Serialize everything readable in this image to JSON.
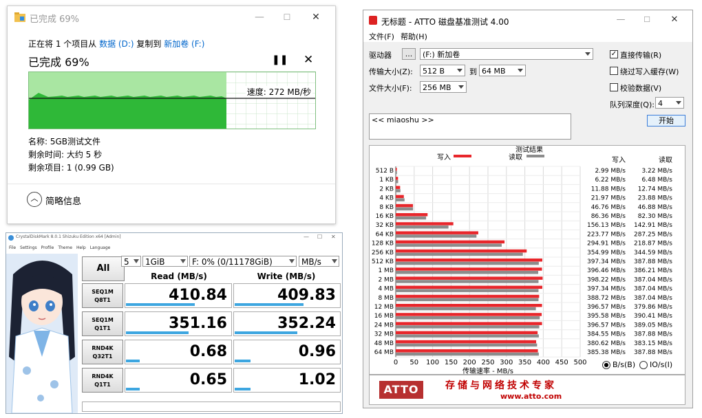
{
  "copy_dialog": {
    "title": "已完成 69%",
    "from_prefix": "正在将 1 个项目从 ",
    "source": "数据 (D:)",
    "mid": " 复制到 ",
    "dest": "新加卷 (F:)",
    "heading": "已完成 69%",
    "progress": 0.69,
    "speed_label": "速度: 272 MB/秒",
    "pause_glyph": "❚❚",
    "cancel_glyph": "✕",
    "name_line": "名称: 5GB测试文件",
    "time_line": "剩余时间: 大约 5 秒",
    "items_line": "剩余项目: 1 (0.99 GB)",
    "more_label": "简略信息",
    "minimize": "—",
    "maximize": "☐",
    "close": "✕"
  },
  "cdm": {
    "title": "CrystalDiskMark 8.0.1 Shizuku Edition x64 [Admin]",
    "menu": [
      "File",
      "Settings",
      "Profile",
      "Theme",
      "Help",
      "Language"
    ],
    "all_label": "All",
    "count": "5",
    "size": "1GiB",
    "drive": "F: 0% (0/11178GiB)",
    "unit": "MB/s",
    "read_header": "Read (MB/s)",
    "write_header": "Write (MB/s)",
    "rows": [
      {
        "l1": "SEQ1M",
        "l2": "Q8T1",
        "read": "410.84",
        "write": "409.83",
        "rfrac": 0.66,
        "wfrac": 0.66
      },
      {
        "l1": "SEQ1M",
        "l2": "Q1T1",
        "read": "351.16",
        "write": "352.24",
        "rfrac": 0.6,
        "wfrac": 0.6
      },
      {
        "l1": "RND4K",
        "l2": "Q32T1",
        "read": "0.68",
        "write": "0.96",
        "rfrac": 0.13,
        "wfrac": 0.15
      },
      {
        "l1": "RND4K",
        "l2": "Q1T1",
        "read": "0.65",
        "write": "1.02",
        "rfrac": 0.13,
        "wfrac": 0.15
      }
    ]
  },
  "atto": {
    "title": "无标题 - ATTO 磁盘基准测试 4.00",
    "menu_file": "文件(F)",
    "menu_help": "帮助(H)",
    "drive_label": "驱动器",
    "browse": "...",
    "drive_value": "(F:) 新加卷",
    "xfer_label": "传输大小(Z):",
    "xfer_from": "512 B",
    "to_label": "到",
    "xfer_to": "64 MB",
    "file_label": "文件大小(F):",
    "file_value": "256 MB",
    "direct": "直接传输(R)",
    "bypass": "绕过写入缓存(W)",
    "verify": "校验数据(V)",
    "queue_label": "队列深度(Q):",
    "queue_value": "4",
    "start": "开始",
    "description": "<< miaoshu >>",
    "results_title": "测试结果",
    "legend_write": "写入",
    "legend_read": "读取",
    "col_write": "写入",
    "col_read": "读取",
    "radio_bs": "B/s(B)",
    "radio_io": "IO/s(I)",
    "logo": "ATTO",
    "slogan": "存储与网络技术专家",
    "url": "www.atto.com",
    "colors": {
      "write": "#e8262b",
      "read": "#8c8c8c"
    },
    "chart_data": {
      "type": "bar",
      "orientation": "horizontal",
      "categories": [
        "512 B",
        "1 KB",
        "2 KB",
        "4 KB",
        "8 KB",
        "16 KB",
        "32 KB",
        "64 KB",
        "128 KB",
        "256 KB",
        "512 KB",
        "1 MB",
        "2 MB",
        "4 MB",
        "8 MB",
        "12 MB",
        "16 MB",
        "24 MB",
        "32 MB",
        "48 MB",
        "64 MB"
      ],
      "series": [
        {
          "name": "写入",
          "values": [
            2.99,
            6.22,
            11.88,
            21.97,
            46.76,
            86.36,
            156.13,
            223.77,
            294.91,
            354.99,
            397.34,
            396.46,
            398.22,
            397.34,
            388.72,
            396.57,
            395.58,
            396.57,
            384.55,
            380.62,
            385.38
          ]
        },
        {
          "name": "读取",
          "values": [
            3.22,
            6.48,
            12.74,
            23.88,
            46.88,
            82.3,
            142.91,
            218.87,
            287.25,
            344.59,
            387.88,
            386.21,
            387.04,
            387.04,
            387.04,
            379.86,
            390.41,
            389.05,
            387.88,
            383.15,
            387.88
          ]
        }
      ],
      "write_labels": [
        "2.99 MB/s",
        "6.22 MB/s",
        "11.88 MB/s",
        "21.97 MB/s",
        "46.76 MB/s",
        "86.36 MB/s",
        "156.13 MB/s",
        "223.77 MB/s",
        "294.91 MB/s",
        "354.99 MB/s",
        "397.34 MB/s",
        "396.46 MB/s",
        "398.22 MB/s",
        "397.34 MB/s",
        "388.72 MB/s",
        "396.57 MB/s",
        "395.58 MB/s",
        "396.57 MB/s",
        "384.55 MB/s",
        "380.62 MB/s",
        "385.38 MB/s"
      ],
      "read_labels": [
        "3.22 MB/s",
        "6.48 MB/s",
        "12.74 MB/s",
        "23.88 MB/s",
        "46.88 MB/s",
        "82.30 MB/s",
        "142.91 MB/s",
        "287.25 MB/s",
        "218.87 MB/s",
        "344.59 MB/s",
        "387.88 MB/s",
        "386.21 MB/s",
        "387.04 MB/s",
        "387.04 MB/s",
        "387.04 MB/s",
        "379.86 MB/s",
        "390.41 MB/s",
        "389.05 MB/s",
        "387.88 MB/s",
        "383.15 MB/s",
        "387.88 MB/s"
      ],
      "xticks": [
        "0",
        "50",
        "100",
        "150",
        "200",
        "250",
        "300",
        "350",
        "400",
        "450",
        "500"
      ],
      "xlim": [
        0,
        500
      ],
      "xlabel": "传输速率 - MB/s",
      "grid": true,
      "legend": "top"
    }
  }
}
